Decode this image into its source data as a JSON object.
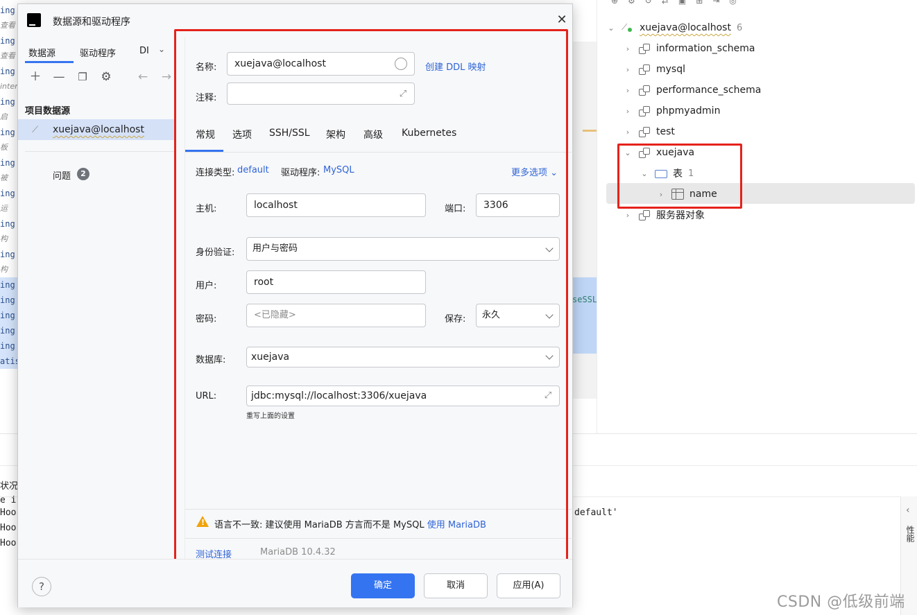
{
  "ide": {
    "gutter_lines": [
      {
        "text": "ing",
        "style": "code"
      },
      {
        "text": "查看",
        "style": "italic"
      },
      {
        "text": "ing",
        "style": "code"
      },
      {
        "text": "查看",
        "style": "italic"
      },
      {
        "text": "ing",
        "style": "code"
      },
      {
        "text": "inter",
        "style": "italic"
      },
      {
        "text": "ing",
        "style": "code"
      },
      {
        "text": "启",
        "style": "italic"
      },
      {
        "text": "ing",
        "style": "code"
      },
      {
        "text": "板",
        "style": "italic"
      },
      {
        "text": "ing",
        "style": "code"
      },
      {
        "text": "被",
        "style": "italic"
      },
      {
        "text": "ing",
        "style": "code"
      },
      {
        "text": "运",
        "style": "italic"
      },
      {
        "text": "ing",
        "style": "code"
      },
      {
        "text": "构",
        "style": "italic"
      },
      {
        "text": "ing",
        "style": "code"
      },
      {
        "text": "构",
        "style": "italic"
      },
      {
        "text": "ing",
        "style": "code"
      },
      {
        "text": "ing",
        "style": "code"
      },
      {
        "text": "ing",
        "style": "code"
      },
      {
        "text": "ing",
        "style": "code"
      },
      {
        "text": "ing",
        "style": "code"
      },
      {
        "text": "atis",
        "style": "code"
      }
    ],
    "mid_text": "seSSL",
    "db_tree": {
      "root_label": "xuejava@localhost",
      "root_count": "6",
      "schemas": [
        "information_schema",
        "mysql",
        "performance_schema",
        "phpmyadmin",
        "test"
      ],
      "xuejava": {
        "label": "xuejava",
        "tables_folder": "表",
        "tables_count": "1",
        "table": "name"
      },
      "server_objects": "服务器对象"
    },
    "bottom": {
      "status_label": "状况",
      "log_lines": [
        "e i",
        "Hook",
        "Hook",
        "Hook"
      ],
      "log_right": "default'",
      "side_tab": "性能"
    },
    "watermark": "CSDN @低级前端"
  },
  "dialog": {
    "title": "数据源和驱动程序",
    "left": {
      "tabs": [
        "数据源",
        "驱动程序",
        "DI"
      ],
      "section_title": "项目数据源",
      "datasource": "xuejava@localhost",
      "problems_label": "问题",
      "problems_count": "2"
    },
    "form": {
      "name_label": "名称:",
      "name_value": "xuejava@localhost",
      "ddl_link": "创建 DDL 映射",
      "comment_label": "注释:",
      "tabs": [
        "常规",
        "选项",
        "SSH/SSL",
        "架构",
        "高级",
        "Kubernetes"
      ],
      "conn_type_label": "连接类型:",
      "conn_type_value": "default",
      "driver_label": "驱动程序:",
      "driver_value": "MySQL",
      "more_options": "更多选项",
      "host_label": "主机:",
      "host_value": "localhost",
      "port_label": "端口:",
      "port_value": "3306",
      "auth_label": "身份验证:",
      "auth_value": "用户与密码",
      "user_label": "用户:",
      "user_value": "root",
      "password_label": "密码:",
      "password_placeholder": "<已隐藏>",
      "save_label": "保存:",
      "save_value": "永久",
      "database_label": "数据库:",
      "database_value": "xuejava",
      "url_label": "URL:",
      "url_value": "jdbc:mysql://localhost:3306/xuejava",
      "url_hint": "重写上面的设置",
      "warning_text": "语言不一致: 建议使用 MariaDB 方言而不是 MySQL",
      "warning_link": "使用 MariaDB",
      "test_connection": "测试连接",
      "server_version": "MariaDB 10.4.32"
    },
    "buttons": {
      "help": "?",
      "ok": "确定",
      "cancel": "取消",
      "apply": "应用(A)"
    }
  },
  "colors": {
    "accent": "#3574f0",
    "link": "#2f64d6",
    "highlight_box": "#e5221b",
    "selection": "#d5e1f7"
  }
}
